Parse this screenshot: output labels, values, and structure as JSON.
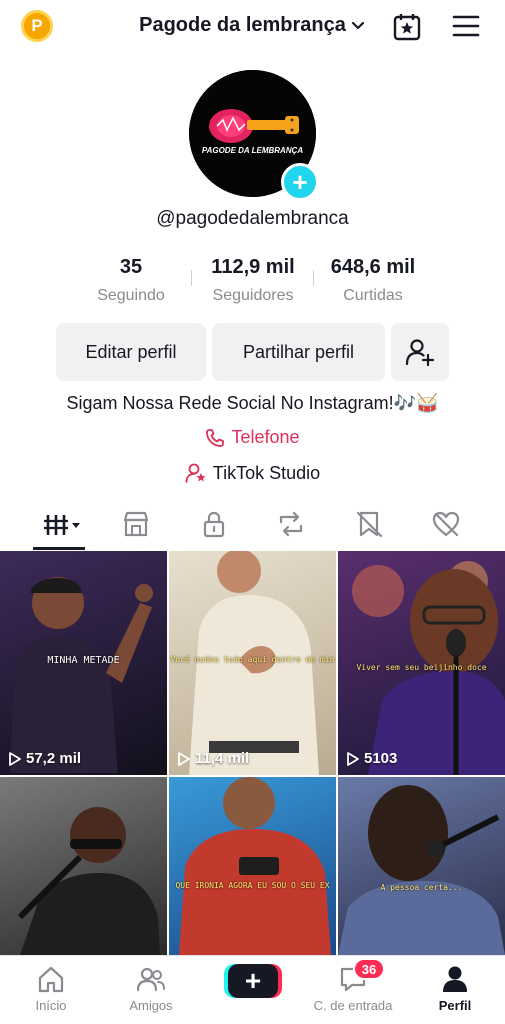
{
  "header": {
    "coin_glyph": "P",
    "title": "Pagode da lembrança",
    "icons": [
      "coin-icon",
      "chevron-down-icon",
      "calendar-star-icon",
      "menu-icon"
    ]
  },
  "profile": {
    "avatar_text": "PAGODE DA LEMBRANÇA",
    "add_glyph": "+",
    "username": "@pagodedalembranca"
  },
  "stats": [
    {
      "value": "35",
      "label": "Seguindo"
    },
    {
      "value": "112,9 mil",
      "label": "Seguidores"
    },
    {
      "value": "648,6 mil",
      "label": "Curtidas"
    }
  ],
  "buttons": {
    "edit": "Editar perfil",
    "share": "Partilhar perfil"
  },
  "bio": "Sigam Nossa Rede Social No Instagram!🎶🥁",
  "links": {
    "phone": "Telefone",
    "studio": "TikTok Studio"
  },
  "tabs": [
    "videos-tab-icon",
    "shop-tab-icon",
    "private-tab-icon",
    "repost-tab-icon",
    "favorites-tab-icon",
    "liked-tab-icon"
  ],
  "videos": [
    {
      "caption": "MINHA METADE",
      "views": "57,2 mil",
      "bg": "#2b2140"
    },
    {
      "caption": "Você mudou tudo aqui dentro de mim",
      "views": "11,4 mil",
      "bg": "#d9cdb6"
    },
    {
      "caption": "Viver sem seu beijinho doce",
      "views": "5103",
      "bg": "#3a2f5c"
    },
    {
      "caption": "",
      "views": "",
      "bg": "#3f3f3f"
    },
    {
      "caption": "QUE IRONIA AGORA EU SOU O SEU EX",
      "views": "",
      "bg": "#2e7fc4"
    },
    {
      "caption": "A pessoa certa...",
      "views": "",
      "bg": "#4a5a8a"
    }
  ],
  "nav": {
    "home": "Início",
    "friends": "Amigos",
    "create_glyph": "+",
    "inbox": "C. de entrada",
    "inbox_badge": "36",
    "profile": "Perfil"
  }
}
